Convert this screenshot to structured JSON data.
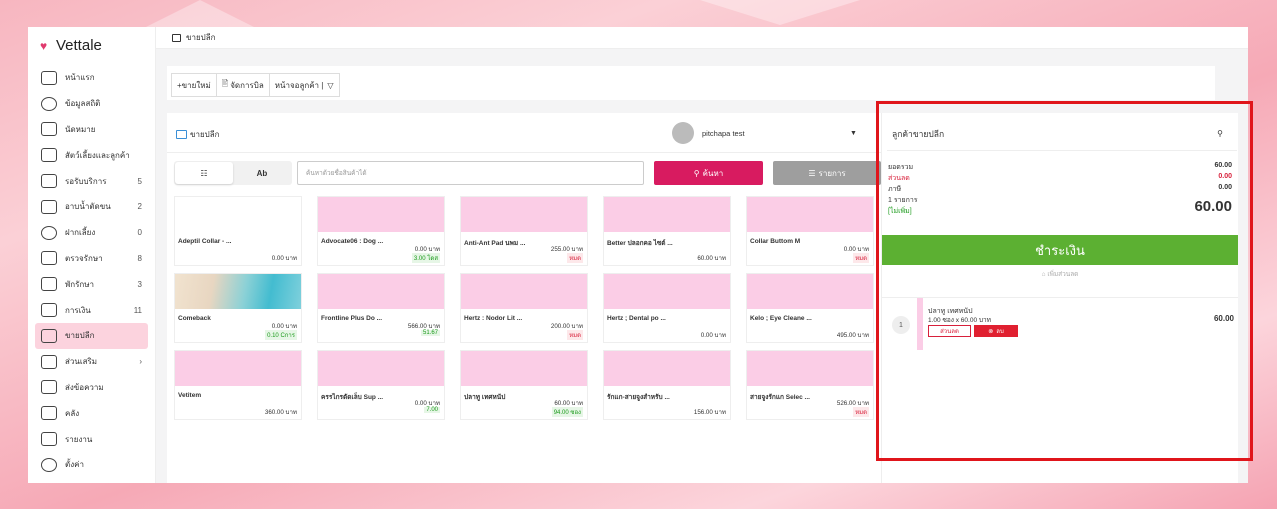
{
  "app": {
    "logo": "Vettale"
  },
  "breadcrumb": "ขายปลีก",
  "sidebar": {
    "items": [
      {
        "label": "หน้าแรก",
        "count": ""
      },
      {
        "label": "ข้อมูลสถิติ",
        "count": ""
      },
      {
        "label": "นัดหมาย",
        "count": ""
      },
      {
        "label": "สัตว์เลี้ยงและลูกค้า",
        "count": ""
      },
      {
        "label": "รอรับบริการ",
        "count": "5"
      },
      {
        "label": "อาบน้ำตัดขน",
        "count": "2"
      },
      {
        "label": "ฝากเลี้ยง",
        "count": "0"
      },
      {
        "label": "ตรวจรักษา",
        "count": "8"
      },
      {
        "label": "พักรักษา",
        "count": "3"
      },
      {
        "label": "การเงิน",
        "count": "11"
      },
      {
        "label": "ขายปลีก",
        "count": ""
      },
      {
        "label": "ส่วนเสริม",
        "count": "›"
      },
      {
        "label": "ส่งข้อความ",
        "count": ""
      },
      {
        "label": "คลัง",
        "count": ""
      },
      {
        "label": "รายงาน",
        "count": ""
      },
      {
        "label": "ตั้งค่า",
        "count": ""
      }
    ]
  },
  "toolbar": {
    "new_sale": "+ขายใหม่",
    "manage_bill": "จัดการบิล",
    "customer_screen": "หน้าจอลูกค้า |"
  },
  "panel": {
    "title": "ขายปลีก",
    "user": "pitchapa test"
  },
  "search": {
    "seg_grid": "☷",
    "seg_ab": "Ab",
    "placeholder": "ค้นหาด้วยชื่อสินค้าได้",
    "search_btn": "ค้นหา",
    "list_btn": "รายการ"
  },
  "products": [
    {
      "name": "Adeptil Collar - ...",
      "price": "0.00 บาท",
      "stock": "",
      "stock_type": "",
      "img": "none"
    },
    {
      "name": "Advocate06 : Dog ...",
      "price": "0.00 บาท",
      "stock": "3.00 โดส",
      "stock_type": "green",
      "img": "pink"
    },
    {
      "name": "Anti-Ant Pad นพม ...",
      "price": "255.00 บาท",
      "stock": "หมด",
      "stock_type": "red",
      "img": "pink"
    },
    {
      "name": "Better ปลอกคอ ไซต์ ...",
      "price": "60.00 บาท",
      "stock": "",
      "stock_type": "",
      "img": "pink"
    },
    {
      "name": "Collar Buttom M",
      "price": "0.00 บาท",
      "stock": "หมด",
      "stock_type": "red",
      "img": "pink"
    },
    {
      "name": "Comeback",
      "price": "0.00 บาท",
      "stock": "0.10 Cการ",
      "stock_type": "green",
      "img": "beach"
    },
    {
      "name": "Frontline Plus Do ...",
      "price": "566.00 บาท",
      "stock": "51.67",
      "stock_type": "green",
      "img": "pink"
    },
    {
      "name": "Hertz : Nodor Lit ...",
      "price": "200.00 บาท",
      "stock": "หมด",
      "stock_type": "red",
      "img": "pink"
    },
    {
      "name": "Hertz ; Dental po ...",
      "price": "0.00 บาท",
      "stock": "",
      "stock_type": "",
      "img": "pink"
    },
    {
      "name": "Kelo ; Eye Cleane ...",
      "price": "495.00 บาท",
      "stock": "",
      "stock_type": "",
      "img": "pink"
    },
    {
      "name": "Vetitem",
      "price": "360.00 บาท",
      "stock": "",
      "stock_type": "",
      "img": "pink"
    },
    {
      "name": "ครรไกรตัดเล็บ Sup ...",
      "price": "0.00 บาท",
      "stock": "7.00",
      "stock_type": "green",
      "img": "pink"
    },
    {
      "name": "ปลาทู เทศหนัป",
      "price": "60.00 บาท",
      "stock": "94.00 ซอง",
      "stock_type": "green",
      "img": "pink"
    },
    {
      "name": "รักแก-สายจูงสำหรับ ...",
      "price": "156.00 บาท",
      "stock": "",
      "stock_type": "",
      "img": "pink"
    },
    {
      "name": "สายจูงรักแก Selec ...",
      "price": "526.00 บาท",
      "stock": "หมด",
      "stock_type": "red",
      "img": "pink"
    }
  ],
  "cart": {
    "title": "ลูกค้าขายปลีก",
    "subtotal_label": "ยอดรวม",
    "subtotal": "60.00",
    "discount_label": "ส่วนลด",
    "discount": "0.00",
    "tax_label": "ภาษี",
    "tax": "0.00",
    "items_label": "1 รายการ",
    "vat_label": "[ไม่เพิ่ม]",
    "total": "60.00",
    "pay_btn": "ชำระเงิน",
    "add_discount": "เพิ่มส่วนลด",
    "line": {
      "index": "1",
      "name": "ปลาทู เทศหนัป",
      "qty": "1.00 ซอง x 60.00 บาท",
      "total": "60.00",
      "discount_btn": "ส่วนลด",
      "delete_btn": "ลบ"
    }
  },
  "colors": {
    "accent": "#d81b60",
    "pay": "#5cb032",
    "highlight": "#e0151b"
  }
}
